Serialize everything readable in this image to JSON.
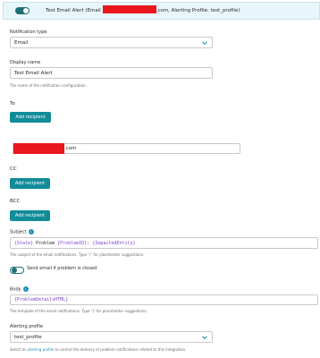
{
  "header": {
    "title_pre": "Test Email Alert (Email",
    "title_post": ".com, Alerting Profile: test_profile)"
  },
  "notification_type": {
    "label": "Notification type",
    "value": "Email"
  },
  "display_name": {
    "label": "Display name",
    "value": "Test Email Alert",
    "help": "The name of the notification configuration."
  },
  "to": {
    "label": "To",
    "button": "Add recipient",
    "recipient_suffix": ".com"
  },
  "cc": {
    "label": "CC",
    "button": "Add recipient"
  },
  "bcc": {
    "label": "BCC",
    "button": "Add recipient"
  },
  "subject": {
    "label": "Subject",
    "info_icon": "i",
    "parts": [
      "{State}",
      " Problem ",
      "{ProblemID}",
      ": ",
      "{ImpactedEntity}"
    ],
    "help": "The subject of the email notifications. Type '{' for placeholder suggestions."
  },
  "send_if_closed": {
    "label": "Send email if problem is closed"
  },
  "body": {
    "label": "Body",
    "info_icon": "i",
    "value": "{ProblemDetailsHTML}",
    "help": "The template of the email notifications. Type '{' for placeholder suggestions."
  },
  "alerting_profile": {
    "label": "Alerting profile",
    "value": "test_profile",
    "help_pre": "Select an",
    "help_link": "alerting profile",
    "help_post": "to control the delivery of problem notifications related to this integration."
  },
  "colors": {
    "accent": "#118c99",
    "link": "#1f8fb5",
    "placeholder": "#7e47c7",
    "header_bg": "#e8f6fb"
  }
}
